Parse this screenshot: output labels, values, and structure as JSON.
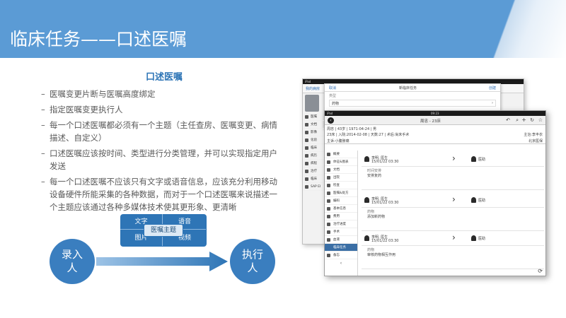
{
  "slide": {
    "title": "临床任务——口述医嘱",
    "section_title": "口述医嘱",
    "bullets": [
      "医嘱变更片断与医嘱高度绑定",
      "指定医嘱变更执行人",
      "每一个口述医嘱都必须有一个主题（主任查房、医嘱变更、病情描述、自定义）",
      "口述医嘱应该按时间、类型进行分类管理，并可以实现指定用户发送",
      "每一个口述医嘱不应该只有文字或语音信息，应该充分利用移动设备硬件所能采集的各种数据，而对于一个口述医嘱来说描述一个主题应该通过各种多媒体技术使其更形象、更清晰"
    ],
    "bullet_dash": "–",
    "media_box": {
      "top_left": "文字",
      "top_right": "语音",
      "bottom_left": "图片",
      "bottom_right": "视频",
      "center": "医嘱主题"
    },
    "flow": {
      "left": "录入人",
      "right": "执行人"
    }
  },
  "back_screen": {
    "status": "iPad",
    "cancel": "取消",
    "title": "新临床任务",
    "create": "创建",
    "left_back": "我的病房",
    "row1": "类型",
    "row2": "药物",
    "side_items": [
      "医嘱",
      "文档",
      "影像",
      "化验",
      "临床",
      "病历",
      "病程",
      "治疗",
      "临床",
      "SAP EI"
    ]
  },
  "front_screen": {
    "status": "iPad",
    "time": "09:23",
    "title": "周忠 - 23床",
    "patient_line1": "周忠 | 43岁 | 1971-04-24 | 男",
    "patient_line2": "23床 | 入院:2014-02-08 | 天数:27 | 术后:尚未手术",
    "attending": "主治:李丰衣",
    "ward": "北京医保",
    "problem": "主诉:小腹胀痛",
    "side_items": [
      "概要",
      "体征&图表",
      "文档",
      "出院",
      "检查",
      "医嘱&处方",
      "编码",
      "基本信息",
      "费用",
      "治疗进度",
      "手术",
      "血液",
      "临床任务",
      "备忘"
    ],
    "active_side_index": 12,
    "cards": [
      {
        "from": "李明, 医生",
        "date": "15/01/22 03:30",
        "to": "医助",
        "label": "时间安排",
        "text": "安排复药"
      },
      {
        "from": "李明, 医生",
        "date": "15/01/22 03:30",
        "to": "医助",
        "label": "药物",
        "text": "添加新药物"
      },
      {
        "from": "李明, 医生",
        "date": "15/01/22 03:30",
        "to": "医助",
        "label": "药物",
        "text": "审核药物相互作用"
      }
    ],
    "colors": {
      "accent": "#3a6ea5",
      "banner": "#5b9bd5"
    }
  }
}
